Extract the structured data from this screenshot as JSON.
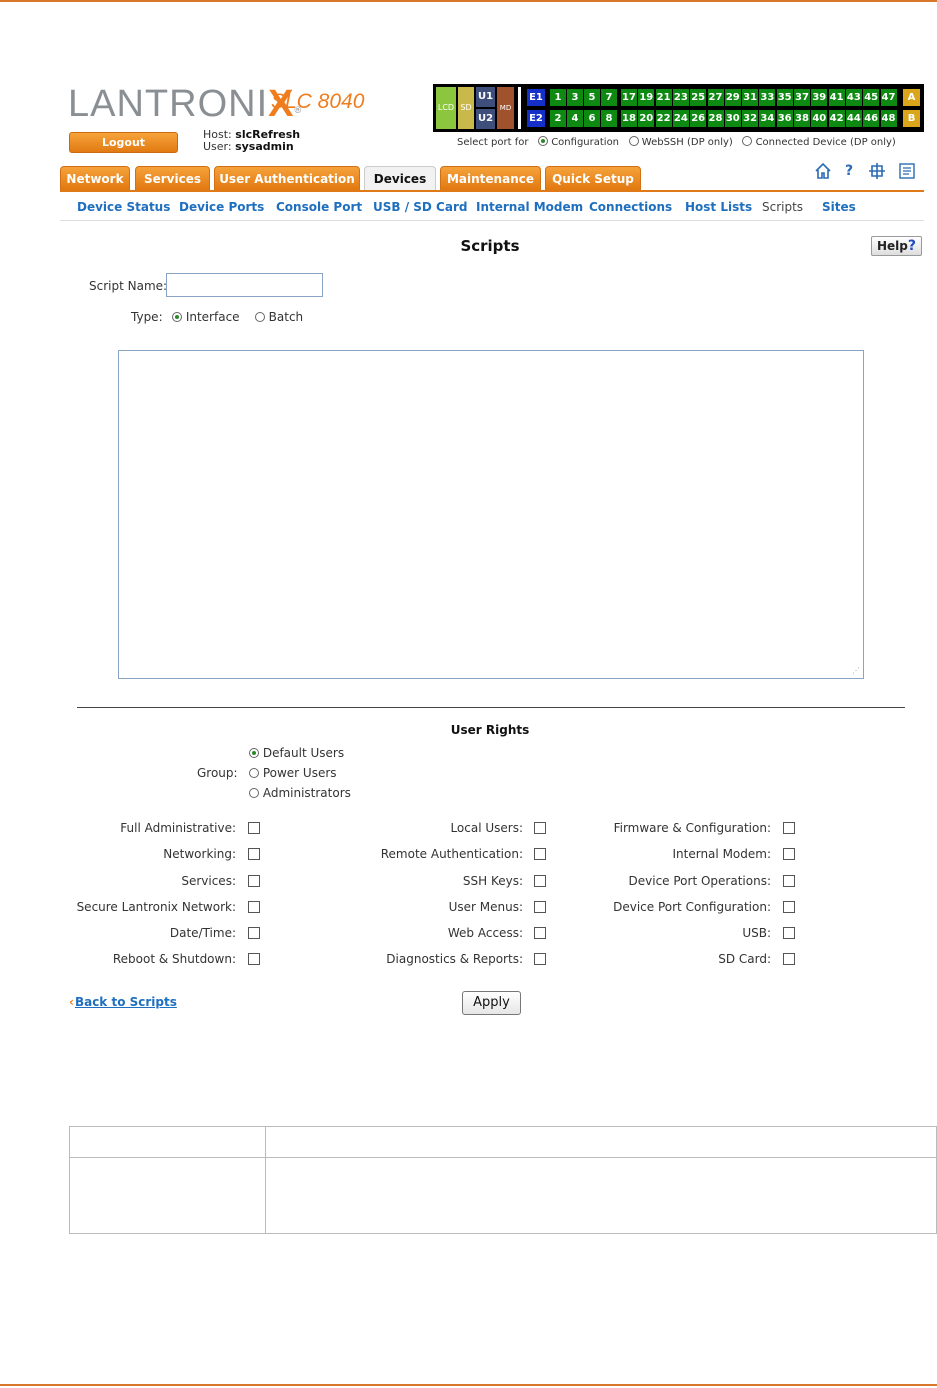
{
  "brand": {
    "logo_main": "LANTRONI",
    "logo_x": "X",
    "logo_reg": "®",
    "model": "SLC 8040"
  },
  "session": {
    "logout_label": "Logout",
    "host_label": "Host:",
    "host_value": "slcRefresh",
    "user_label": "User:",
    "user_value": "sysadmin"
  },
  "port_panel": {
    "lcd": "LCD",
    "sd": "SD",
    "u1": "U1",
    "u2": "U2",
    "md": "MD",
    "e1": "E1",
    "e2": "E2",
    "top_ports": [
      "1",
      "3",
      "5",
      "7",
      "17",
      "19",
      "21",
      "23",
      "25",
      "27",
      "29",
      "31",
      "33",
      "35",
      "37",
      "39",
      "41",
      "43",
      "45",
      "47"
    ],
    "bottom_ports": [
      "2",
      "4",
      "6",
      "8",
      "18",
      "20",
      "22",
      "24",
      "26",
      "28",
      "30",
      "32",
      "34",
      "36",
      "38",
      "40",
      "42",
      "44",
      "46",
      "48"
    ],
    "a": "A",
    "b": "B",
    "colors": {
      "green": "#0e8a12",
      "blue": "#1530c8",
      "gold": "#dba61a",
      "lcd": "#8cc63f",
      "sd": "#c9b84a",
      "u": "#3d4f7a",
      "md": "#a0522d"
    }
  },
  "select_port": {
    "label": "Select port for",
    "options": [
      "Configuration",
      "WebSSH (DP only)",
      "Connected Device (DP only)"
    ],
    "selected": "Configuration"
  },
  "tabs": [
    "Network",
    "Services",
    "User Authentication",
    "Devices",
    "Maintenance",
    "Quick Setup"
  ],
  "active_tab": "Devices",
  "toolbar_icons": [
    "home-icon",
    "help-icon",
    "sitemap-icon",
    "notes-icon"
  ],
  "subnav": [
    "Device Status",
    "Device Ports",
    "Console Port",
    "USB / SD Card",
    "Internal Modem",
    "Connections",
    "Host Lists",
    "Scripts",
    "Sites"
  ],
  "current_subnav": "Scripts",
  "page_title": "Scripts",
  "help_label": "Help",
  "form": {
    "script_name_label": "Script Name:",
    "script_name_value": "",
    "type_label": "Type:",
    "type_options": [
      "Interface",
      "Batch"
    ],
    "type_selected": "Interface",
    "script_body": ""
  },
  "user_rights": {
    "title": "User Rights",
    "group_label": "Group:",
    "groups": [
      "Default Users",
      "Power Users",
      "Administrators"
    ],
    "group_selected": "Default Users",
    "col1": [
      "Full Administrative:",
      "Networking:",
      "Services:",
      "Secure Lantronix Network:",
      "Date/Time:",
      "Reboot & Shutdown:"
    ],
    "col2": [
      "Local Users:",
      "Remote Authentication:",
      "SSH Keys:",
      "User Menus:",
      "Web Access:",
      "Diagnostics & Reports:"
    ],
    "col3": [
      "Firmware & Configuration:",
      "Internal Modem:",
      "Device Port Operations:",
      "Device Port Configuration:",
      "USB:",
      "SD Card:"
    ]
  },
  "footer": {
    "back_label": "Back to Scripts",
    "apply_label": "Apply"
  },
  "accent_colors": {
    "orange": "#ef7d1e",
    "link_blue": "#1f6fbf"
  }
}
